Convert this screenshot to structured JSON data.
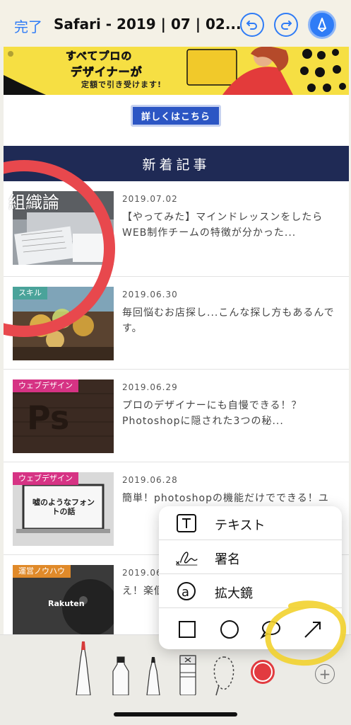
{
  "header": {
    "done_label": "完了",
    "title": "Safari - 2019 | 07 | 02...",
    "undo_icon": "undo-icon",
    "redo_icon": "redo-icon",
    "markup_icon": "markup-pen-icon",
    "accent_color": "#2f7cf6"
  },
  "page": {
    "banner": {
      "line1": "すべてプロの",
      "line2": "デザイナーが",
      "line3": "定額で引き受けます!"
    },
    "detail_button": "詳しくはこちら",
    "section_title": "新着記事",
    "overlay_text": "組織論",
    "articles": [
      {
        "category": "",
        "category_color": "",
        "date": "2019.07.02",
        "title": "【やってみた】マインドレッスンをしたらWEB制作チームの特徴が分かった..."
      },
      {
        "category": "スキル",
        "category_color": "#4aa39a",
        "date": "2019.06.30",
        "title": "毎回悩むお店探し...こんな探し方もあるんです。"
      },
      {
        "category": "ウェブデザイン",
        "category_color": "#d63384",
        "date": "2019.06.29",
        "title": "プロのデザイナーにも自慢できる！？Photoshopに隠された3つの秘..."
      },
      {
        "category": "ウェブデザイン",
        "category_color": "#d63384",
        "date": "2019.06.28",
        "title": "簡単！photoshopの機能だけでできる！ユ"
      },
      {
        "category": "運営ノウハウ",
        "category_color": "#e08a2a",
        "date": "2019.06",
        "title": "え！楽個以上"
      }
    ],
    "thumb_texts": {
      "font_title": "嘘のようなフォントの話",
      "rakuten": "Rakuten"
    }
  },
  "popup": {
    "items": [
      {
        "label": "テキスト",
        "icon": "text-box-icon"
      },
      {
        "label": "署名",
        "icon": "signature-icon"
      },
      {
        "label": "拡大鏡",
        "icon": "magnifier-icon"
      }
    ],
    "shapes": [
      "square-shape-icon",
      "circle-shape-icon",
      "speech-bubble-icon",
      "arrow-icon"
    ]
  },
  "toolbar": {
    "tools": [
      "pen-tool-icon",
      "marker-tool-icon",
      "pencil-tool-icon",
      "eraser-tool-icon",
      "lasso-tool-icon",
      "color-picker-icon",
      "add-icon"
    ],
    "selected_color": "#e23b40"
  },
  "colors": {
    "section_bg": "#1f2a55",
    "annotation_red": "#e8484d",
    "annotation_yellow": "#f2d22e"
  }
}
